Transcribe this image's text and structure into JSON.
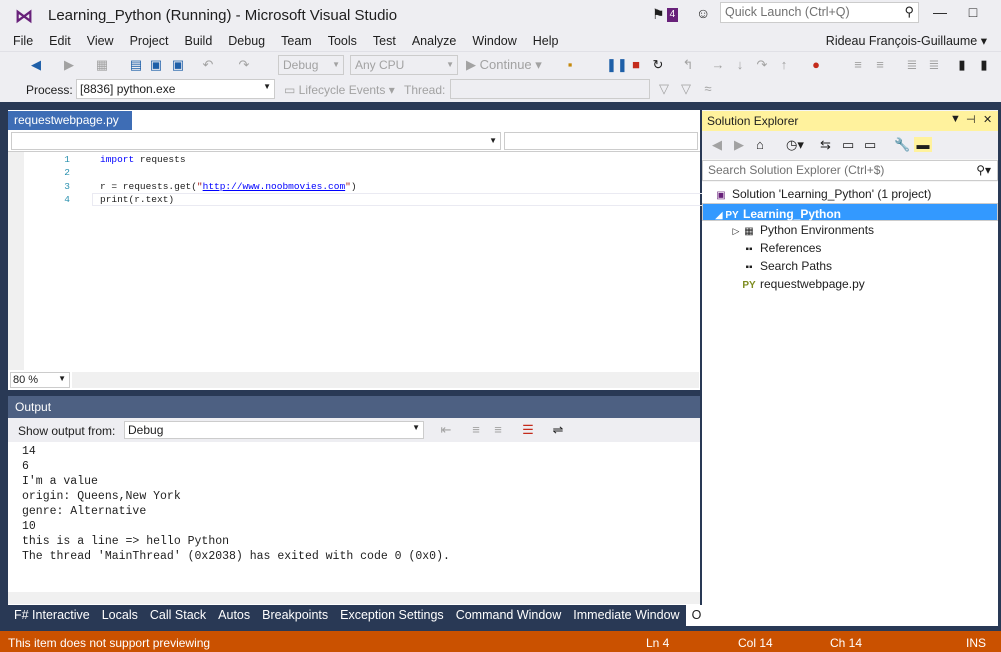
{
  "app": {
    "title": "Learning_Python (Running) - Microsoft Visual Studio",
    "notification_count": "4",
    "quick_launch_placeholder": "Quick Launch (Ctrl+Q)",
    "user": "Rideau François-Guillaume",
    "accent": "#68217a"
  },
  "menu": [
    "File",
    "Edit",
    "View",
    "Project",
    "Build",
    "Debug",
    "Team",
    "Tools",
    "Test",
    "Analyze",
    "Window",
    "Help"
  ],
  "toolbar": {
    "config": "Debug",
    "platform": "Any CPU",
    "continue_label": "Continue",
    "process_label": "Process:",
    "process_value": "[8836] python.exe",
    "lifecycle_label": "Lifecycle Events",
    "thread_label": "Thread:"
  },
  "editor": {
    "tab": "requestwebpage.py",
    "zoom": "80 %",
    "lines": [
      {
        "n": "1",
        "kw": "import",
        "rest": " requests"
      },
      {
        "n": "2",
        "kw": "",
        "rest": ""
      },
      {
        "n": "3",
        "pre": "r = requests.get(",
        "q1": "\"",
        "url": "http://www.noobmovies.com",
        "q2": "\"",
        ")": ")"
      },
      {
        "n": "4",
        "text": "print(r.text)"
      }
    ]
  },
  "output": {
    "title": "Output",
    "show_from_label": "Show output from:",
    "source": "Debug",
    "text": "14\n6\nI'm a value\norigin: Queens,New York\ngenre: Alternative\n10\nthis is a line => hello Python\nThe thread 'MainThread' (0x2038) has exited with code 0 (0x0)."
  },
  "bottom_tabs": [
    "F# Interactive",
    "Locals",
    "Call Stack",
    "Autos",
    "Breakpoints",
    "Exception Settings",
    "Command Window",
    "Immediate Window",
    "Output"
  ],
  "solution_explorer": {
    "title": "Solution Explorer",
    "search_placeholder": "Search Solution Explorer (Ctrl+$)",
    "solution": "Solution 'Learning_Python' (1 project)",
    "project": "Learning_Python",
    "items": [
      "Python Environments",
      "References",
      "Search Paths",
      "requestwebpage.py"
    ]
  },
  "status": {
    "message": "This item does not support previewing",
    "ln": "Ln 4",
    "col": "Col 14",
    "ch": "Ch 14",
    "mode": "INS",
    "color": "#ca5100"
  }
}
